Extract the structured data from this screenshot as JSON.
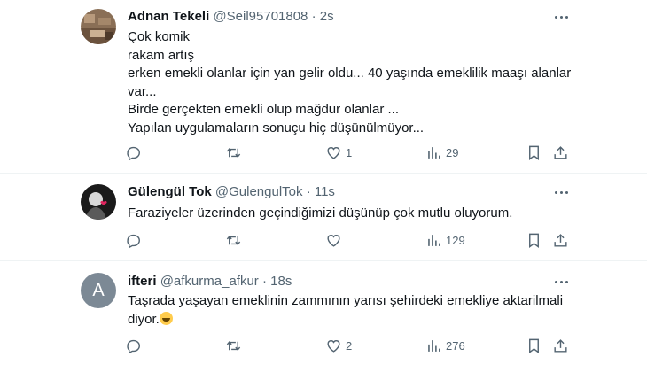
{
  "tweets": [
    {
      "name": "Adnan Tekeli",
      "handle": "@Seil95701808",
      "sep": "·",
      "time": "2s",
      "lines": [
        "Çok komik",
        "rakam artış",
        "erken emekli olanlar için yan gelir oldu... 40 yaşında emeklilik maaşı alanlar",
        "var...",
        "Birde gerçekten emekli olup mağdur olanlar ...",
        "Yapılan uygulamaların sonuçu hiç düşünülmüyor..."
      ],
      "replies": "",
      "retweets": "",
      "likes": "1",
      "views": "29"
    },
    {
      "name": "Gülengül Tok",
      "handle": "@GulengulTok",
      "sep": "·",
      "time": "11s",
      "lines": [
        "Faraziyeler üzerinden geçindiğimizi düşünüp çok mutlu oluyorum."
      ],
      "replies": "",
      "retweets": "",
      "likes": "",
      "views": "129"
    },
    {
      "name": "ifteri",
      "handle": "@afkurma_afkur",
      "sep": "·",
      "time": "18s",
      "avatar_letter": "A",
      "lines": [
        "Taşrada yaşayan emeklinin zammının yarısı şehirdeki emekliye aktarilmali",
        "diyor."
      ],
      "emoji": "grinning-face-emoji",
      "replies": "",
      "retweets": "",
      "likes": "2",
      "views": "276"
    }
  ],
  "icons": {
    "reply": "reply-icon",
    "retweet": "retweet-icon",
    "like": "heart-icon",
    "views": "views-icon",
    "bookmark": "bookmark-icon",
    "share": "share-icon",
    "more": "more-icon"
  },
  "colors": {
    "text": "#0f1419",
    "secondary": "#536471",
    "divider": "#eff3f4",
    "avatar_letter_bg": "#7c8995"
  }
}
